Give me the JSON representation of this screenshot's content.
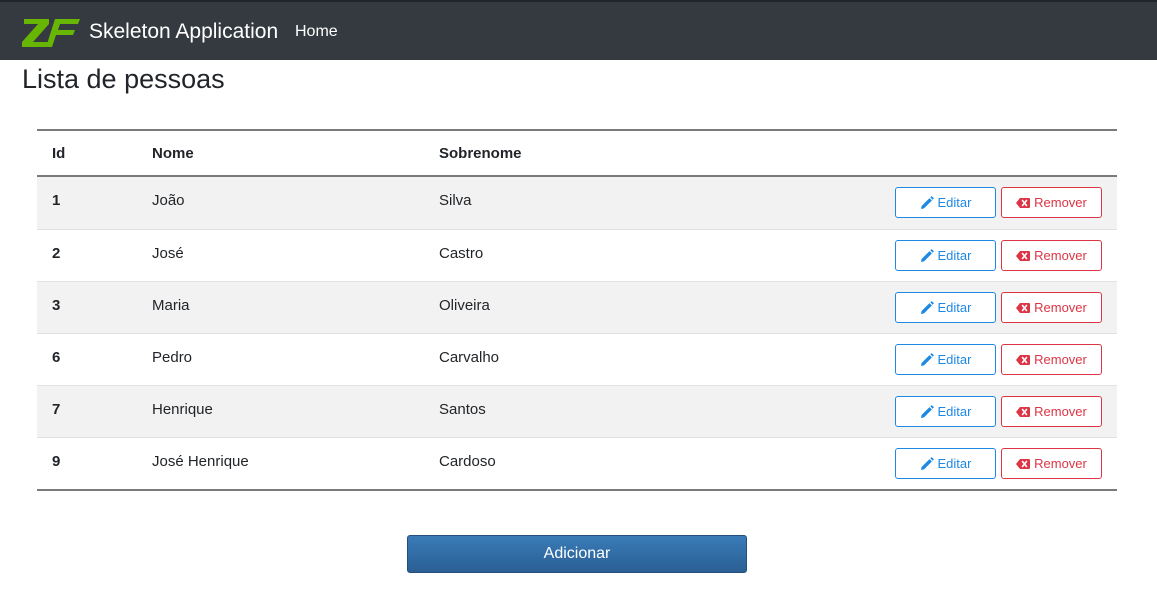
{
  "navbar": {
    "brand": "Skeleton Application",
    "home_label": "Home"
  },
  "page": {
    "title": "Lista de pessoas",
    "add_label": "Adicionar"
  },
  "table": {
    "headers": [
      "Id",
      "Nome",
      "Sobrenome"
    ],
    "edit_label": "Editar",
    "remove_label": "Remover",
    "rows": [
      {
        "id": "1",
        "nome": "João",
        "sobrenome": "Silva"
      },
      {
        "id": "2",
        "nome": "José",
        "sobrenome": "Castro"
      },
      {
        "id": "3",
        "nome": "Maria",
        "sobrenome": "Oliveira"
      },
      {
        "id": "6",
        "nome": "Pedro",
        "sobrenome": "Carvalho"
      },
      {
        "id": "7",
        "nome": "Henrique",
        "sobrenome": "Santos"
      },
      {
        "id": "9",
        "nome": "José Henrique",
        "sobrenome": "Cardoso"
      }
    ]
  },
  "icons": {
    "logo": "zf-logo-icon",
    "edit": "pencil-icon",
    "remove": "remove-x-icon"
  },
  "colors": {
    "navbar_bg": "#343a40",
    "logo_green": "#68b604",
    "edit_blue": "#1e88e5",
    "remove_red": "#dc3545",
    "add_button": "#2a5f94"
  }
}
